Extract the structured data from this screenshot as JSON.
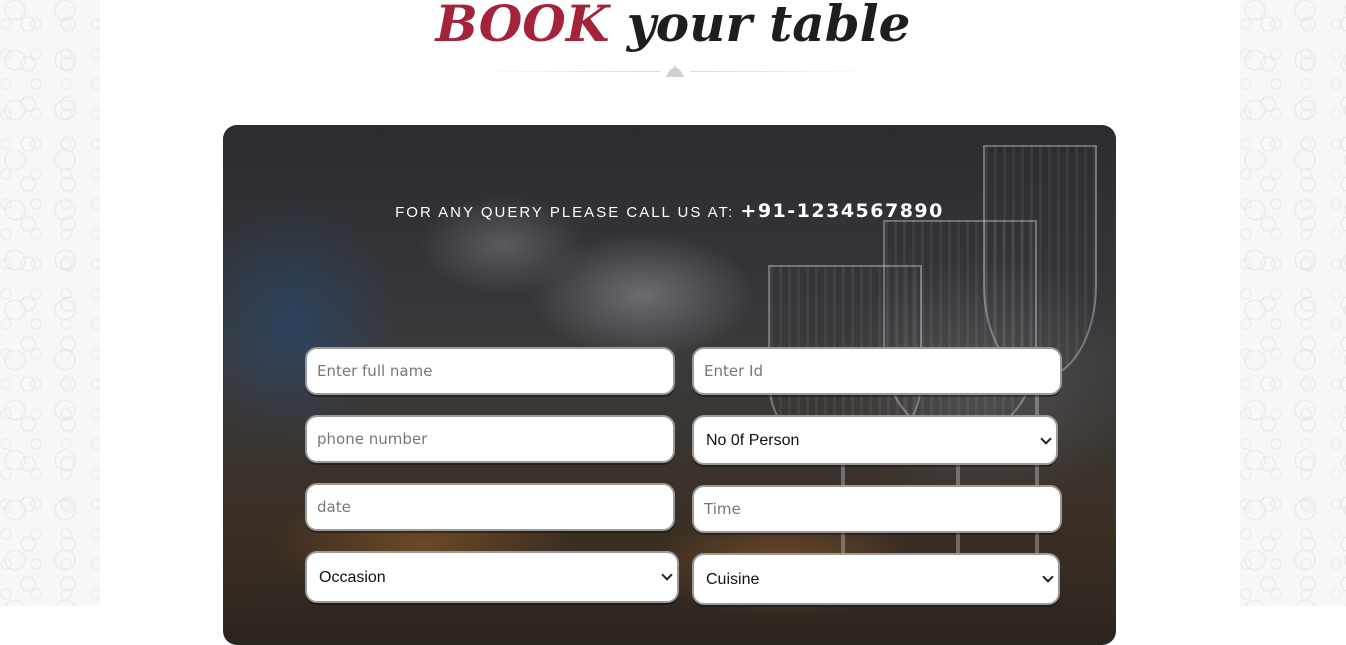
{
  "heading": {
    "accent": "BOOK",
    "rest": " your table"
  },
  "query": {
    "text": "FOR ANY QUERY PLEASE CALL US AT:",
    "phone": "+91-1234567890"
  },
  "form": {
    "full_name_placeholder": "Enter full name",
    "id_placeholder": "Enter Id",
    "phone_placeholder": "phone number",
    "persons_selected": "No 0f Person",
    "date_placeholder": "date",
    "time_placeholder": "Time",
    "occasion_selected": "Occasion",
    "cuisine_selected": "Cuisine"
  },
  "colors": {
    "accent": "#a4233a",
    "heading": "#1e1e1e"
  }
}
